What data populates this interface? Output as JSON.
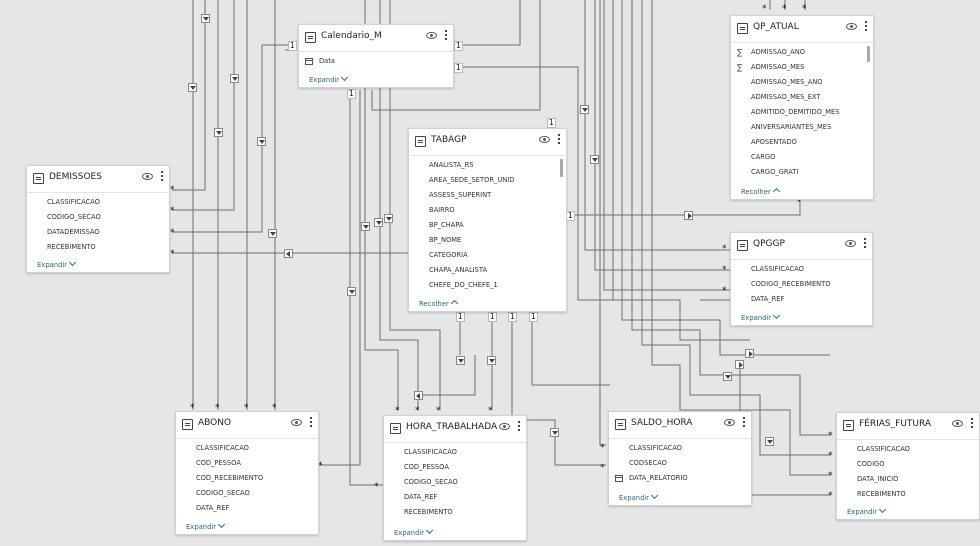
{
  "tables": {
    "calendario": {
      "name": "Calendario_M",
      "fields": [
        "Data"
      ],
      "toggle": "Expandir"
    },
    "tabagp": {
      "name": "TABAGP",
      "fields": [
        "ANALISTA_RS",
        "AREA_SEDE_SETOR_UNID",
        "ASSESS_SUPERINT",
        "BAIRRO",
        "BP_CHAPA",
        "BP_NOME",
        "CATEGORIA",
        "CHAPA_ANALISTA",
        "CHEFE_DO_CHEFE_1"
      ],
      "toggle": "Recolher"
    },
    "qp_atual": {
      "name": "QP_ATUAL",
      "fields": [
        "ADMISSAO_ANO",
        "ADMISSAO_MES",
        "ADMISSAO_MES_ANO",
        "ADMISSAO_MES_EXT",
        "ADMITIDO_DEMITIDO_MES",
        "ANIVERSARIANTES_MES",
        "APOSENTADO",
        "CARGO",
        "CARGO_GRATI"
      ],
      "toggle": "Recolher"
    },
    "demissoes": {
      "name": "DEMISSOES",
      "fields": [
        "CLASSIFICACAO",
        "CODIGO_SECAO",
        "DATADEMISSAO",
        "RECEBIMENTO"
      ],
      "toggle": "Expandir"
    },
    "qpggp": {
      "name": "QPGGP",
      "fields": [
        "CLASSIFICACAO",
        "CODIGO_RECEBIMENTO",
        "DATA_REF"
      ],
      "toggle": "Expandir"
    },
    "abono": {
      "name": "ABONO",
      "fields": [
        "CLASSIFICACAO",
        "COD_PESSOA",
        "COD_RECEBIMENTO",
        "CODIGO_SECAO",
        "DATA_REF"
      ],
      "toggle": "Expandir"
    },
    "hora": {
      "name": "HORA_TRABALHADA",
      "fields": [
        "CLASSIFICACAO",
        "COD_PESSOA",
        "CODIGO_SECAO",
        "DATA_REF",
        "RECEBIMENTO"
      ],
      "toggle": "Expandir"
    },
    "saldo": {
      "name": "SALDO_HORA",
      "fields": [
        "CLASSIFICACAO",
        "CODSECAO",
        "DATA_RELATORIO"
      ],
      "toggle": "Expandir"
    },
    "ferias": {
      "name": "FÉRIAS_FUTURA",
      "fields": [
        "CLASSIFICACAO",
        "CODIGO",
        "DATA_INICIO",
        "RECEBIMENTO"
      ],
      "toggle": "Expandir"
    }
  },
  "cardinality": {
    "one": "1",
    "many": "*"
  }
}
